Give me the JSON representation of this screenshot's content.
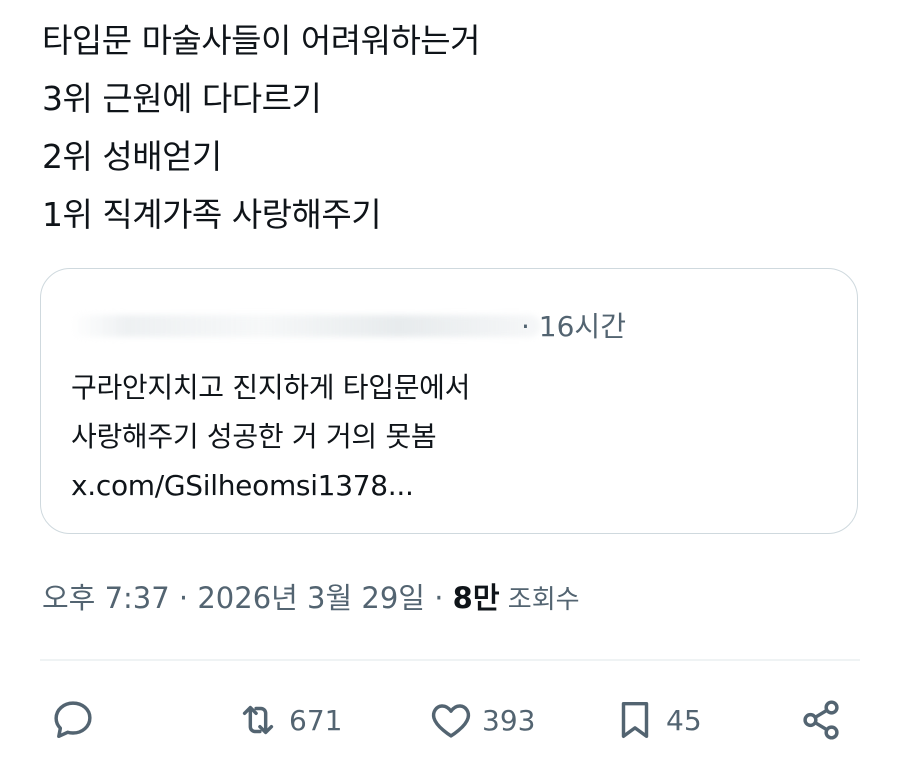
{
  "tweet": {
    "lines": [
      "타입문 마술사들이 어려워하는거",
      "3위 근원에 다다르기",
      "2위 성배얻기",
      "1위 직계가족 사랑해주기"
    ]
  },
  "quote": {
    "author_hidden": true,
    "meta": "· 16시간",
    "lines": [
      "구라안지치고 진지하게 타입문에서",
      "사랑해주기 성공한 거  거의 못봄"
    ],
    "link": "x.com/GSilheomsi1378..."
  },
  "meta": {
    "time": "오후 7:37",
    "separator1": " · ",
    "date": "2026년 3월 29일",
    "separator2": " · ",
    "views_count": "8만",
    "views_label": " 조회수"
  },
  "actions": {
    "reply": {
      "icon": "reply-icon",
      "count": ""
    },
    "repost": {
      "icon": "repost-icon",
      "count": "671"
    },
    "like": {
      "icon": "heart-icon",
      "count": "393"
    },
    "bookmark": {
      "icon": "bookmark-icon",
      "count": "45"
    },
    "share": {
      "icon": "share-icon",
      "count": ""
    }
  },
  "colors": {
    "text": "#0f1419",
    "secondary": "#536471",
    "border": "#cfd9de",
    "divider": "#eff3f4"
  }
}
